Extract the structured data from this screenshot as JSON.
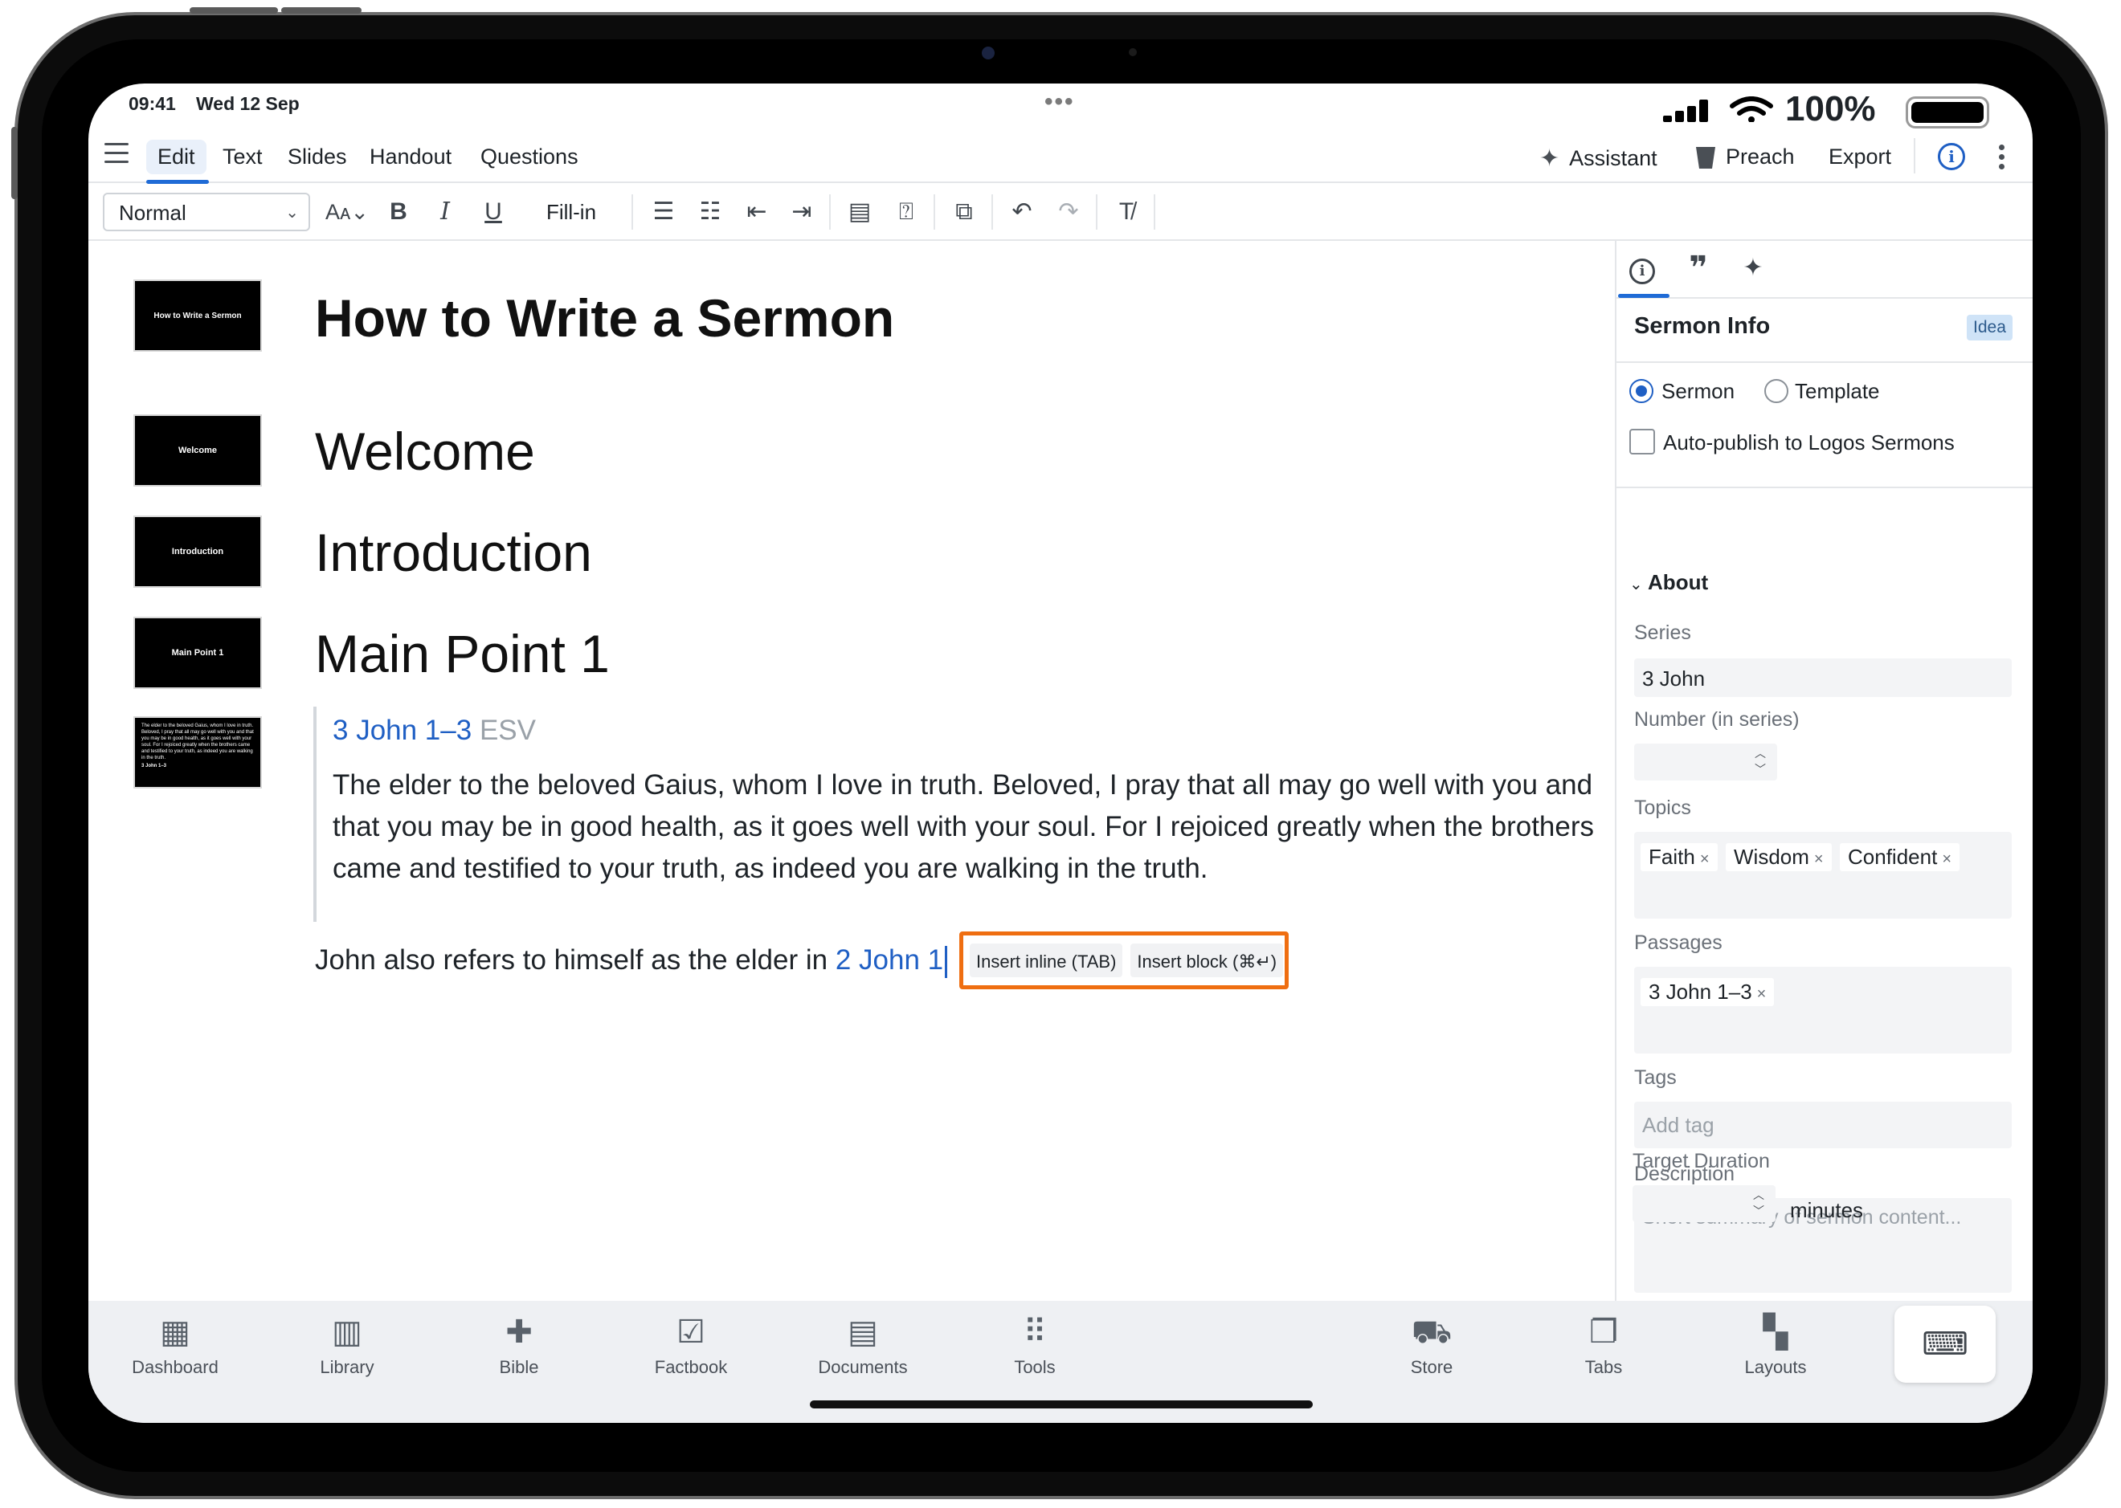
{
  "status": {
    "time": "09:41",
    "date": "Wed 12 Sep",
    "battery": "100%"
  },
  "menu": {
    "tabs": [
      "Edit",
      "Text",
      "Slides",
      "Handout",
      "Questions"
    ],
    "assistant": "Assistant",
    "preach": "Preach",
    "export": "Export"
  },
  "toolbar": {
    "style": "Normal",
    "fill_in": "Fill-in"
  },
  "slides": [
    {
      "label": "How to Write a Sermon"
    },
    {
      "label": "Welcome"
    },
    {
      "label": "Introduction"
    },
    {
      "label": "Main Point 1"
    },
    {
      "label": "The elder to the beloved Gaius, whom I love in truth. Beloved, I pray that all may go well with you and that you may be in good health, as it goes well with your soul. For I rejoiced greatly when the brothers came and testified to your truth, as indeed you are walking in the truth.",
      "ref": "3 John 1–3"
    }
  ],
  "document": {
    "title": "How to Write a Sermon",
    "headings": [
      "Welcome",
      "Introduction",
      "Main Point 1"
    ],
    "passage": {
      "reference": "3 John 1–3",
      "version": "ESV",
      "text": "The elder to the beloved Gaius, whom I love in truth. Beloved, I pray that all may go well with you and that you may be in good health, as it goes well with your soul. For I rejoiced greatly when the brothers came and testified to your truth, as indeed you are walking in the truth."
    },
    "body_text": "John also refers to himself as the elder in ",
    "body_link": "2 John 1",
    "suggest": {
      "inline": "Insert inline (TAB)",
      "block": "Insert block (⌘↵)"
    }
  },
  "panel": {
    "title": "Sermon Info",
    "badge": "Idea",
    "radio_sermon": "Sermon",
    "radio_template": "Template",
    "autopublish": "Auto-publish to Logos Sermons",
    "about": "About",
    "series_label": "Series",
    "series_value": "3 John",
    "number_label": "Number (in series)",
    "topics_label": "Topics",
    "topics": [
      "Faith",
      "Wisdom",
      "Confident"
    ],
    "passages_label": "Passages",
    "passages": [
      "3 John 1–3"
    ],
    "tags_label": "Tags",
    "tags_placeholder": "Add tag",
    "description_label": "Description",
    "description_placeholder": "Short summary of sermon content...",
    "duration_label": "Target Duration",
    "duration_unit": "minutes"
  },
  "dock": {
    "items": [
      "Dashboard",
      "Library",
      "Bible",
      "Factbook",
      "Documents",
      "Tools",
      "Store",
      "Tabs",
      "Layouts"
    ]
  },
  "icons": {
    "accent": "#1f5fc4",
    "highlight": "#ef6e11"
  }
}
